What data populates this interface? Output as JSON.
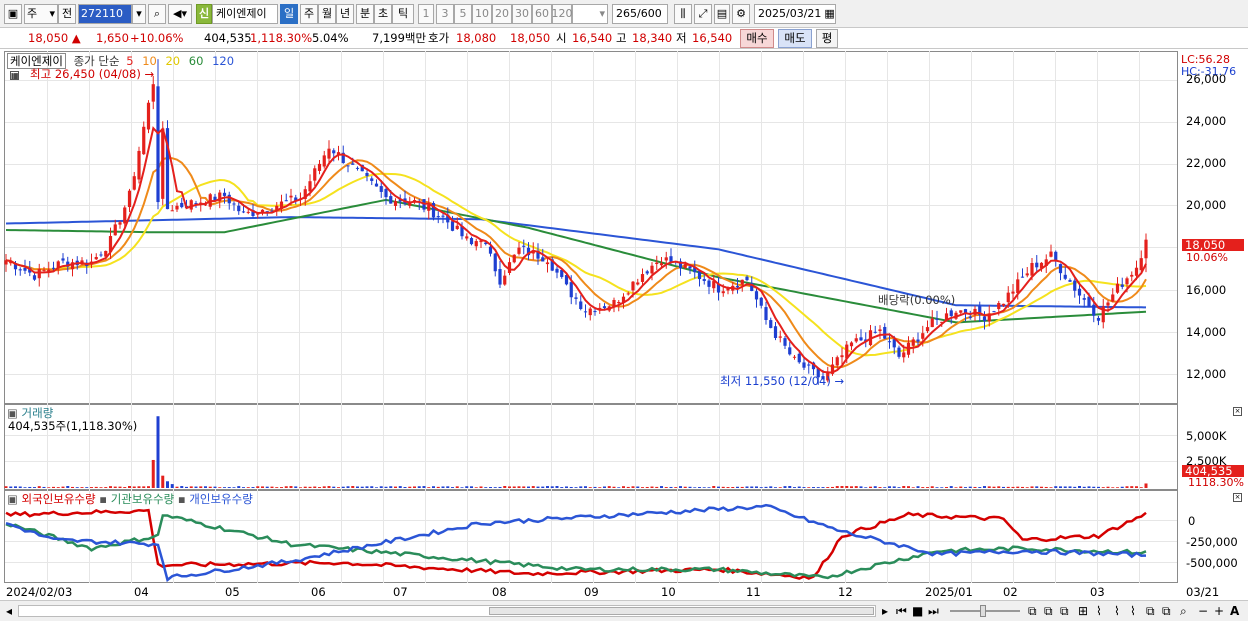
{
  "toolbar": {
    "market": "주",
    "prev_label": "전",
    "code": "272110",
    "badge": "신",
    "stock_name": "케이엔제이",
    "periods": [
      "일",
      "주",
      "월",
      "년",
      "분",
      "초",
      "틱"
    ],
    "period_selected": "일",
    "intervals": [
      "1",
      "3",
      "5",
      "10",
      "20",
      "30",
      "60",
      "120"
    ],
    "count": "265",
    "count_total": "/600",
    "date": "2025/03/21"
  },
  "quote": {
    "price": "18,050",
    "change": "1,650",
    "change_pct": "+10.06%",
    "volume": "404,535",
    "volume_pct": "1,118.30%",
    "turnover_ratio": "5.04%",
    "amount": "7,199백만",
    "ask_label": "호가",
    "ask": "18,080",
    "bid": "18,050",
    "open_label": "시",
    "open": "16,540",
    "high_label": "고",
    "high": "18,340",
    "low_label": "저",
    "low": "16,540",
    "buy_label": "매수",
    "sell_label": "매도",
    "avg_label": "평"
  },
  "price_panel": {
    "name": "케이엔제이",
    "ma_label": "종가 단순",
    "ma_periods": [
      "5",
      "10",
      "20",
      "60",
      "120"
    ],
    "ma_colors": [
      "#e4201c",
      "#ef8a1a",
      "#f5e21e",
      "#2a8c3a",
      "#2b55d6"
    ],
    "high_note": "최고 26,450 (04/08)",
    "low_note": "최저 11,550 (12/04)",
    "dividend_note": "배당락(0.00%)",
    "lc": "LC:56.28",
    "hc": "HC:-31.76",
    "yticks": [
      "26,000",
      "24,000",
      "22,000",
      "20,000",
      "18,000",
      "16,000",
      "14,000",
      "12,000"
    ],
    "current_price": "18,050",
    "current_pct": "10.06%"
  },
  "volume_panel": {
    "title": "거래량",
    "summary": "404,535주(1,118.30%)",
    "yticks": [
      "5,000K",
      "2,500K"
    ],
    "current": "404,535",
    "current_pct": "1118.30%"
  },
  "holding_panel": {
    "series": [
      "외국인보유수량",
      "기관보유수량",
      "개인보유수량"
    ],
    "series_colors": [
      "#d40000",
      "#2a8c5a",
      "#2b55d6"
    ],
    "yticks": [
      "0",
      "-250,000",
      "-500,000"
    ]
  },
  "xaxis": {
    "labels": [
      "2024/02/03",
      "04",
      "05",
      "06",
      "07",
      "08",
      "09",
      "10",
      "11",
      "12",
      "2025/01",
      "02",
      "03",
      "03/21"
    ]
  },
  "chart_data": {
    "type": "candlestick",
    "price_scale": [
      10500,
      26500
    ],
    "close_path": [
      [
        0,
        17100
      ],
      [
        6,
        16400
      ],
      [
        12,
        17000
      ],
      [
        18,
        17000
      ],
      [
        22,
        18000
      ],
      [
        26,
        20100
      ],
      [
        32,
        26450
      ],
      [
        34,
        19500
      ],
      [
        40,
        19800
      ],
      [
        46,
        20100
      ],
      [
        50,
        19200
      ],
      [
        56,
        19600
      ],
      [
        62,
        20000
      ],
      [
        68,
        22400
      ],
      [
        74,
        21200
      ],
      [
        80,
        20000
      ],
      [
        86,
        19800
      ],
      [
        92,
        19100
      ],
      [
        98,
        17800
      ],
      [
        100,
        18200
      ],
      [
        104,
        16200
      ],
      [
        108,
        17600
      ],
      [
        114,
        17200
      ],
      [
        118,
        15800
      ],
      [
        122,
        14800
      ],
      [
        128,
        15100
      ],
      [
        134,
        16500
      ],
      [
        138,
        17200
      ],
      [
        144,
        16600
      ],
      [
        150,
        15800
      ],
      [
        156,
        16200
      ],
      [
        160,
        14300
      ],
      [
        166,
        12400
      ],
      [
        172,
        11550
      ],
      [
        178,
        13200
      ],
      [
        184,
        13800
      ],
      [
        188,
        12600
      ],
      [
        194,
        14000
      ],
      [
        200,
        14800
      ],
      [
        206,
        14500
      ],
      [
        210,
        15200
      ],
      [
        216,
        16800
      ],
      [
        220,
        17300
      ],
      [
        226,
        15500
      ],
      [
        230,
        14500
      ],
      [
        234,
        15800
      ],
      [
        238,
        16800
      ],
      [
        240,
        18050
      ]
    ],
    "ma_levels": {
      "ma120": [
        [
          0,
          18800
        ],
        [
          60,
          19100
        ],
        [
          100,
          19000
        ],
        [
          150,
          17600
        ],
        [
          200,
          15000
        ],
        [
          240,
          14900
        ]
      ],
      "ma60": [
        [
          0,
          18500
        ],
        [
          30,
          18400
        ],
        [
          46,
          18400
        ],
        [
          80,
          19900
        ],
        [
          110,
          18600
        ],
        [
          150,
          16300
        ],
        [
          200,
          14200
        ],
        [
          240,
          14700
        ]
      ]
    },
    "volume_spikes": [
      [
        31,
        2500000
      ],
      [
        32,
        6400000
      ],
      [
        240,
        404535
      ]
    ],
    "holding": {
      "foreign": [
        [
          0,
          50000
        ],
        [
          30,
          100000
        ],
        [
          32,
          -550000
        ],
        [
          70,
          -520000
        ],
        [
          110,
          -650000
        ],
        [
          150,
          -600000
        ],
        [
          170,
          -700000
        ],
        [
          176,
          -200000
        ],
        [
          190,
          50000
        ],
        [
          210,
          0
        ],
        [
          214,
          -250000
        ],
        [
          230,
          -200000
        ],
        [
          240,
          60000
        ]
      ],
      "institution": [
        [
          0,
          -50000
        ],
        [
          18,
          -350000
        ],
        [
          32,
          -200000
        ],
        [
          33,
          50000
        ],
        [
          60,
          -300000
        ],
        [
          120,
          -600000
        ],
        [
          150,
          -600000
        ],
        [
          172,
          -700000
        ],
        [
          196,
          -380000
        ],
        [
          214,
          -350000
        ],
        [
          240,
          -400000
        ]
      ],
      "individual": [
        [
          0,
          -50000
        ],
        [
          10,
          -250000
        ],
        [
          32,
          -300000
        ],
        [
          34,
          -700000
        ],
        [
          60,
          -500000
        ],
        [
          100,
          -50000
        ],
        [
          160,
          150000
        ],
        [
          176,
          -150000
        ],
        [
          196,
          -420000
        ],
        [
          214,
          -380000
        ],
        [
          240,
          -430000
        ]
      ]
    }
  }
}
